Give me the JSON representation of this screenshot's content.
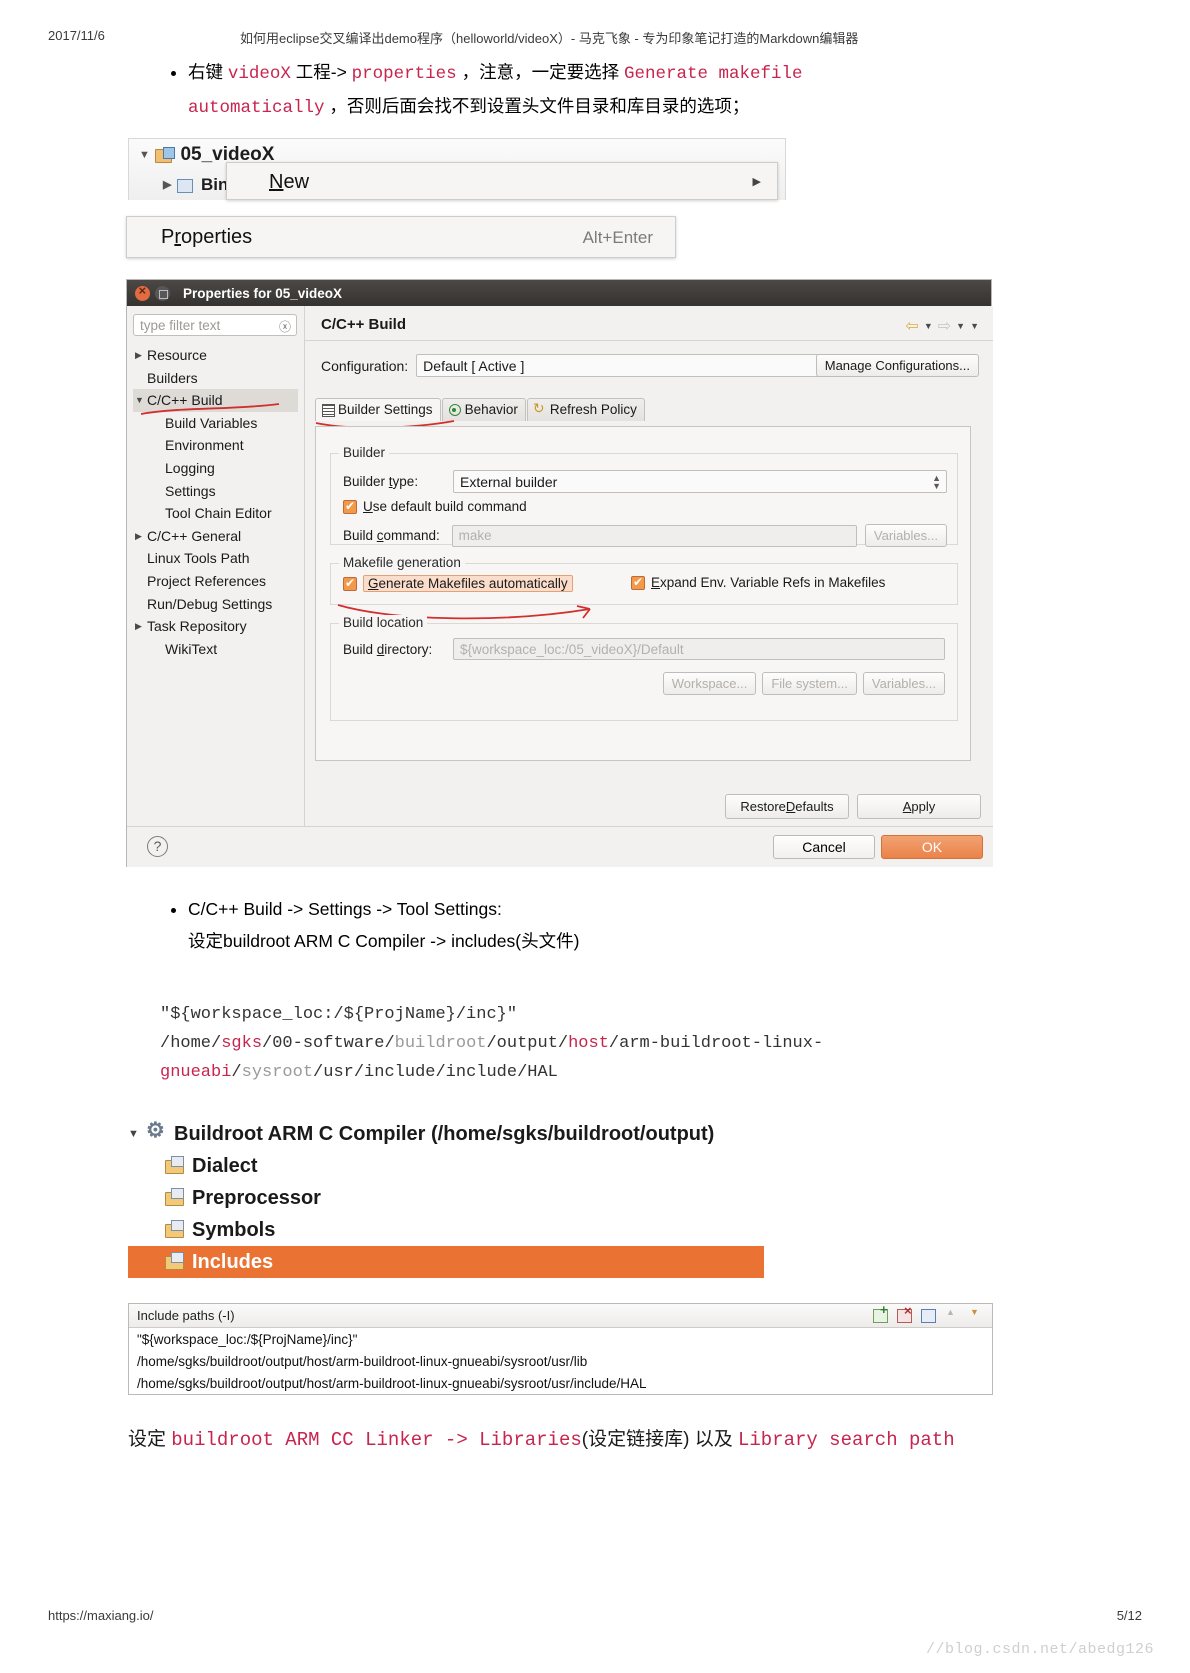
{
  "page": {
    "date": "2017/11/6",
    "header_title": "如何用eclipse交叉编译出demo程序（helloworld/videoX）- 马克飞象 - 专为印象笔记打造的Markdown编辑器",
    "footer_url": "https://maxiang.io/",
    "page_number": "5/12",
    "watermark": "//blog.csdn.net/abedg126"
  },
  "bullet1": {
    "seg1": "右键 ",
    "code1": "videoX",
    "seg2": " 工程-> ",
    "code2": "properties",
    "seg3": " ，注意，一定要选择 ",
    "code3": "Generate makefile",
    "code4": "automatically",
    "seg4": " ，否则后面会找不到设置头文件目录和库目录的选项；"
  },
  "explorer": {
    "project": "05_videoX",
    "child": "Bin",
    "project_icon": "project-icon",
    "bin_icon": "binaries-icon",
    "expand_icon": "triangle-down-icon",
    "collapse_icon": "triangle-right-icon"
  },
  "context_menu": {
    "new_label": "New",
    "new_accel_icon": "submenu-arrow-icon",
    "properties_label": "Properties",
    "properties_accel": "Alt+Enter"
  },
  "dialog": {
    "title": "Properties for 05_videoX",
    "close_icon": "close-icon",
    "maximize_icon": "maximize-icon",
    "filter_placeholder": "type filter text",
    "filter_clear_icon": "clear-icon",
    "tree": [
      {
        "label": "Resource",
        "level": 0,
        "arrow": "right",
        "selected": false
      },
      {
        "label": "Builders",
        "level": 0,
        "arrow": "none",
        "selected": false
      },
      {
        "label": "C/C++ Build",
        "level": 0,
        "arrow": "down",
        "selected": true
      },
      {
        "label": "Build Variables",
        "level": 1,
        "arrow": "none",
        "selected": false
      },
      {
        "label": "Environment",
        "level": 1,
        "arrow": "none",
        "selected": false
      },
      {
        "label": "Logging",
        "level": 1,
        "arrow": "none",
        "selected": false
      },
      {
        "label": "Settings",
        "level": 1,
        "arrow": "none",
        "selected": false
      },
      {
        "label": "Tool Chain Editor",
        "level": 1,
        "arrow": "none",
        "selected": false
      },
      {
        "label": "C/C++ General",
        "level": 0,
        "arrow": "right",
        "selected": false
      },
      {
        "label": "Linux Tools Path",
        "level": 0,
        "arrow": "none",
        "selected": false
      },
      {
        "label": "Project References",
        "level": 0,
        "arrow": "none",
        "selected": false
      },
      {
        "label": "Run/Debug Settings",
        "level": 0,
        "arrow": "none",
        "selected": false
      },
      {
        "label": "Task Repository",
        "level": 0,
        "arrow": "right",
        "selected": false
      },
      {
        "label": "WikiText",
        "level": 1,
        "arrow": "none",
        "selected": false
      }
    ],
    "page_title": "C/C++ Build",
    "nav": {
      "back_icon": "arrow-left-icon",
      "back_menu_icon": "chevron-down-icon",
      "forward_icon": "arrow-right-icon",
      "forward_menu_icon": "chevron-down-icon"
    },
    "configuration_label": "Configuration:",
    "configuration_value": "Default [ Active ]",
    "manage_configurations": "Manage Configurations...",
    "tabs": [
      {
        "label": "Builder Settings",
        "icon": "lines-icon",
        "active": true
      },
      {
        "label": "Behavior",
        "icon": "radio-icon",
        "active": false
      },
      {
        "label": "Refresh Policy",
        "icon": "refresh-icon",
        "active": false
      }
    ],
    "builder_group": "Builder",
    "builder_type_label": "Builder type:",
    "builder_type_value": "External builder",
    "use_default_build_command": "Use default build command",
    "build_command_label": "Build command:",
    "build_command_value": "make",
    "variables_button": "Variables...",
    "makefile_group": "Makefile generation",
    "generate_makefiles": "Generate Makefiles automatically",
    "expand_env": "Expand Env. Variable Refs in Makefiles",
    "build_location_group": "Build location",
    "build_directory_label": "Build directory:",
    "build_directory_value": "${workspace_loc:/05_videoX}/Default",
    "workspace_button": "Workspace...",
    "filesystem_button": "File system...",
    "variables_button2": "Variables...",
    "restore_defaults": "Restore Defaults",
    "apply": "Apply",
    "help_icon": "help-icon",
    "cancel": "Cancel",
    "ok": "OK",
    "accent_color": "#ea8249"
  },
  "bullet2": {
    "line1": "C/C++ Build -> Settings -> Tool Settings:",
    "line2": "设定buildroot ARM C Compiler -> includes(头文件)"
  },
  "code_block": {
    "line1": "\"${workspace_loc:/${ProjName}/inc}\"",
    "line2_a": "/home/",
    "line2_b": "sgks",
    "line2_c": "/00-software/",
    "line2_d": "buildroot",
    "line2_e": "/output/",
    "line2_f": "host",
    "line2_g": "/arm-buildroot-linux-",
    "line3_a": "gnueabi",
    "line3_b": "/",
    "line3_c": "sysroot",
    "line3_d": "/usr/include/include/HAL"
  },
  "tool_tree": {
    "root": "Buildroot ARM C Compiler (/home/sgks/buildroot/output)",
    "root_icon": "gear-icon",
    "expand_icon": "triangle-down-icon",
    "items": [
      {
        "label": "Dialect",
        "icon": "folder-icon",
        "selected": false
      },
      {
        "label": "Preprocessor",
        "icon": "folder-icon",
        "selected": false
      },
      {
        "label": "Symbols",
        "icon": "folder-icon",
        "selected": false
      },
      {
        "label": "Includes",
        "icon": "folder-icon",
        "selected": true
      }
    ],
    "selected_color": "#ea7333"
  },
  "include_paths": {
    "header": "Include paths (-I)",
    "tools": [
      "add-icon",
      "delete-icon",
      "edit-icon",
      "move-up-icon",
      "move-down-icon"
    ],
    "rows": [
      "\"${workspace_loc:/${ProjName}/inc}\"",
      "/home/sgks/buildroot/output/host/arm-buildroot-linux-gnueabi/sysroot/usr/lib",
      "/home/sgks/buildroot/output/host/arm-buildroot-linux-gnueabi/sysroot/usr/include/HAL"
    ]
  },
  "tail": {
    "zh1": "设定 ",
    "cd1": "buildroot ARM CC Linker -> Libraries",
    "zh2": "(设定链接库) ",
    "zh3": "以及 ",
    "cd2": "Library search path"
  }
}
